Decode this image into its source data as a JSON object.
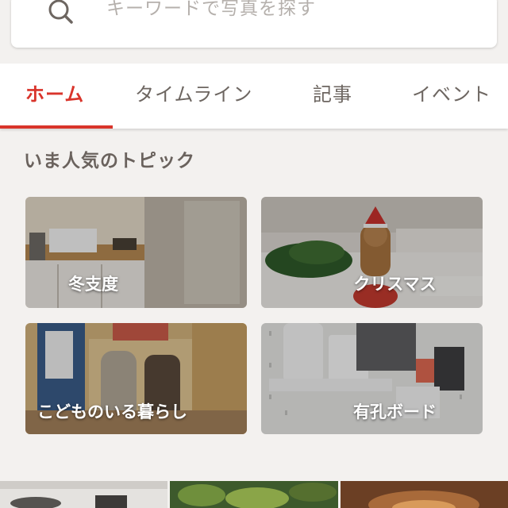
{
  "search": {
    "placeholder": "キーワードで写真を探す"
  },
  "tabs": [
    {
      "label": "ホーム",
      "active": true
    },
    {
      "label": "タイムライン",
      "active": false
    },
    {
      "label": "記事",
      "active": false
    },
    {
      "label": "イベント",
      "active": false
    }
  ],
  "section": {
    "title": "いま人気のトピック"
  },
  "topics": [
    {
      "label": "冬支度"
    },
    {
      "label": "クリスマス"
    },
    {
      "label": "こどものいる暮らし"
    },
    {
      "label": "有孔ボード"
    }
  ],
  "colors": {
    "accent": "#d9342b",
    "background": "#f3f1ef"
  }
}
